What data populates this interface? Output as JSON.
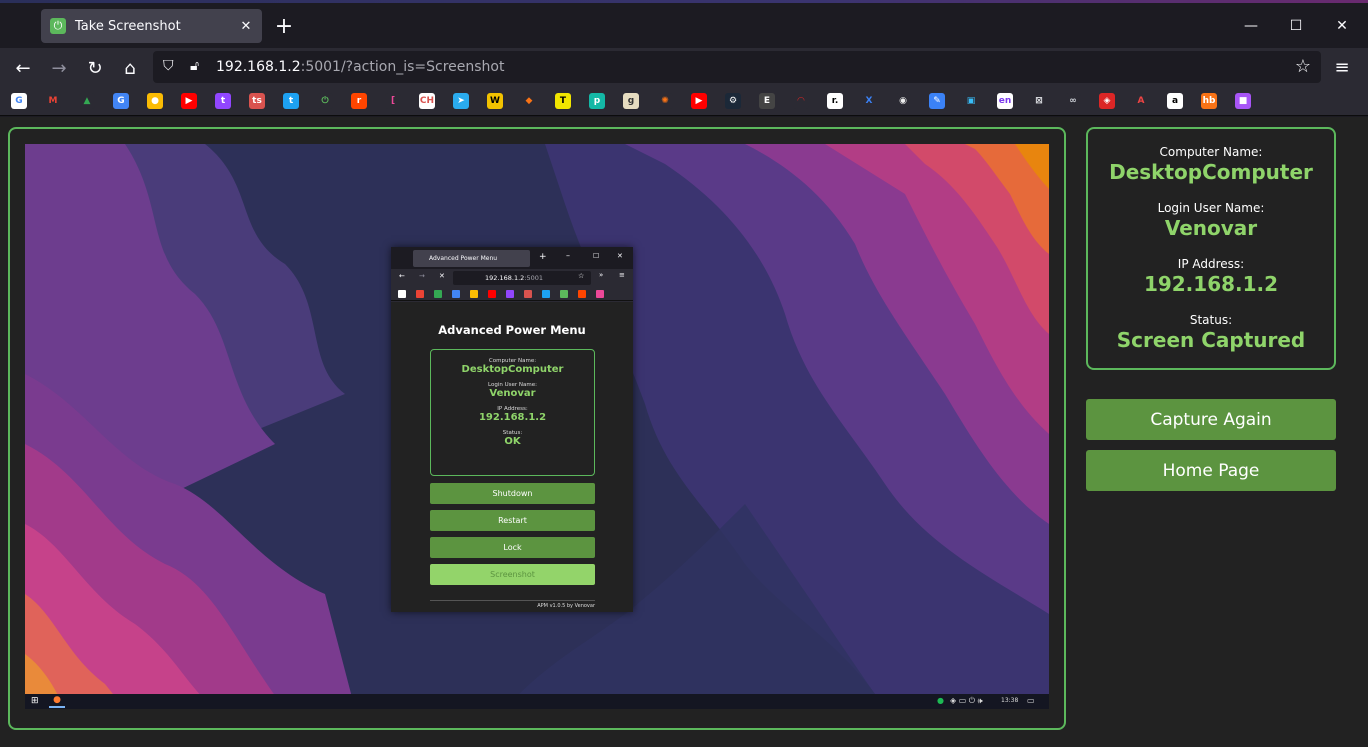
{
  "browser": {
    "tab_title": "Take Screenshot",
    "tab_close": "✕",
    "new_tab": "+",
    "url_host": "192.168.1.2",
    "url_rest": ":5001/?action_is=Screenshot",
    "window_controls": {
      "minimize": "—",
      "maximize": "☐",
      "close": "✕"
    },
    "nav_icons": [
      "back-icon",
      "forward-icon",
      "reload-icon",
      "home-icon"
    ],
    "bookmarks": [
      {
        "icon": "google-icon",
        "glyph": "G",
        "color": "#ffffff",
        "fg": "#4285f4"
      },
      {
        "icon": "gmail-icon",
        "glyph": "M",
        "color": "#2b2a33",
        "fg": "#ea4335"
      },
      {
        "icon": "drive-icon",
        "glyph": "▲",
        "color": "#2b2a33",
        "fg": "#34a853"
      },
      {
        "icon": "translate-icon",
        "glyph": "G",
        "color": "#4285f4",
        "fg": "#ffffff"
      },
      {
        "icon": "keep-icon",
        "glyph": "●",
        "color": "#fbbc04",
        "fg": "#ffffff"
      },
      {
        "icon": "youtube-icon",
        "glyph": "▶",
        "color": "#ff0000",
        "fg": "#ffffff"
      },
      {
        "icon": "twitch-icon",
        "glyph": "t",
        "color": "#9146ff",
        "fg": "#ffffff"
      },
      {
        "icon": "ts-icon",
        "glyph": "ts",
        "color": "#d9534f",
        "fg": "#ffffff"
      },
      {
        "icon": "twitter-icon",
        "glyph": "t",
        "color": "#1da1f2",
        "fg": "#ffffff"
      },
      {
        "icon": "power-icon",
        "glyph": "⏻",
        "color": "#2b2a33",
        "fg": "#5cb85c"
      },
      {
        "icon": "reddit-icon",
        "glyph": "r",
        "color": "#ff4500",
        "fg": "#ffffff"
      },
      {
        "icon": "bracket-icon",
        "glyph": "[",
        "color": "#2b2a33",
        "fg": "#ec4899"
      },
      {
        "icon": "ch-icon",
        "glyph": "CH",
        "color": "#ffffff",
        "fg": "#d9534f"
      },
      {
        "icon": "telegram-icon",
        "glyph": "➤",
        "color": "#2aabee",
        "fg": "#ffffff"
      },
      {
        "icon": "w-icon",
        "glyph": "W",
        "color": "#f2c200",
        "fg": "#000000"
      },
      {
        "icon": "brave-icon",
        "glyph": "◆",
        "color": "#2b2a33",
        "fg": "#f97316"
      },
      {
        "icon": "t-yellow-icon",
        "glyph": "T",
        "color": "#f2e600",
        "fg": "#000000"
      },
      {
        "icon": "p-icon",
        "glyph": "p",
        "color": "#14b8a6",
        "fg": "#ffffff"
      },
      {
        "icon": "g-beige-icon",
        "glyph": "g",
        "color": "#e6dcc0",
        "fg": "#333333"
      },
      {
        "icon": "sun-icon",
        "glyph": "✺",
        "color": "#2b2a33",
        "fg": "#f97316"
      },
      {
        "icon": "youtube-music-icon",
        "glyph": "▶",
        "color": "#ff0000",
        "fg": "#ffffff"
      },
      {
        "icon": "steam-icon",
        "glyph": "⚙",
        "color": "#1b2838",
        "fg": "#ffffff"
      },
      {
        "icon": "epic-icon",
        "glyph": "E",
        "color": "#444444",
        "fg": "#ffffff"
      },
      {
        "icon": "speedometer-icon",
        "glyph": "◠",
        "color": "#2b2a33",
        "fg": "#dc2626"
      },
      {
        "icon": "r-icon",
        "glyph": "r.",
        "color": "#ffffff",
        "fg": "#000000"
      },
      {
        "icon": "tiles-icon",
        "glyph": "X",
        "color": "#2b2a33",
        "fg": "#3b82f6"
      },
      {
        "icon": "penguin-icon",
        "glyph": "◉",
        "color": "#2b2a33",
        "fg": "#eeeeee"
      },
      {
        "icon": "wrench-icon",
        "glyph": "✎",
        "color": "#3b82f6",
        "fg": "#ffffff"
      },
      {
        "icon": "frame-icon",
        "glyph": "▣",
        "color": "#2b2a33",
        "fg": "#38bdf8"
      },
      {
        "icon": "en-icon",
        "glyph": "en",
        "color": "#ffffff",
        "fg": "#7c3aed"
      },
      {
        "icon": "grid-icon",
        "glyph": "⊠",
        "color": "#2b2a33",
        "fg": "#e5e7eb"
      },
      {
        "icon": "glasses-icon",
        "glyph": "∞",
        "color": "#2b2a33",
        "fg": "#d1d5db"
      },
      {
        "icon": "shield-red-icon",
        "glyph": "◈",
        "color": "#dc2626",
        "fg": "#ffffff"
      },
      {
        "icon": "a-icon",
        "glyph": "A",
        "color": "#2b2a33",
        "fg": "#ef4444"
      },
      {
        "icon": "amazon-icon",
        "glyph": "a",
        "color": "#ffffff",
        "fg": "#000000"
      },
      {
        "icon": "hb-icon",
        "glyph": "hb",
        "color": "#f97316",
        "fg": "#ffffff"
      },
      {
        "icon": "purple-icon",
        "glyph": "■",
        "color": "#a855f7",
        "fg": "#ffffff"
      }
    ]
  },
  "screenshot": {
    "mini_tab_title": "Advanced Power Menu",
    "mini_url_host": "192.168.1.2",
    "mini_url_rest": ":5001",
    "title": "Advanced Power Menu",
    "computer_name_label": "Computer Name:",
    "computer_name": "DesktopComputer",
    "user_label": "Login User Name:",
    "user": "Venovar",
    "ip_label": "IP Address:",
    "ip": "192.168.1.2",
    "status_label": "Status:",
    "status": "OK",
    "buttons": [
      "Shutdown",
      "Restart",
      "Lock",
      "Screenshot"
    ],
    "footer": "APM v1.0.5 by Venovar",
    "clock": "13:38"
  },
  "info": {
    "computer_name_label": "Computer Name:",
    "computer_name": "DesktopComputer",
    "user_label": "Login User Name:",
    "user": "Venovar",
    "ip_label": "IP Address:",
    "ip": "192.168.1.2",
    "status_label": "Status:",
    "status": "Screen Captured"
  },
  "actions": {
    "capture_again": "Capture Again",
    "home_page": "Home Page"
  },
  "colors": {
    "accent": "#5cb85c",
    "value_green": "#8fd46a",
    "button_green": "#5c9440"
  }
}
